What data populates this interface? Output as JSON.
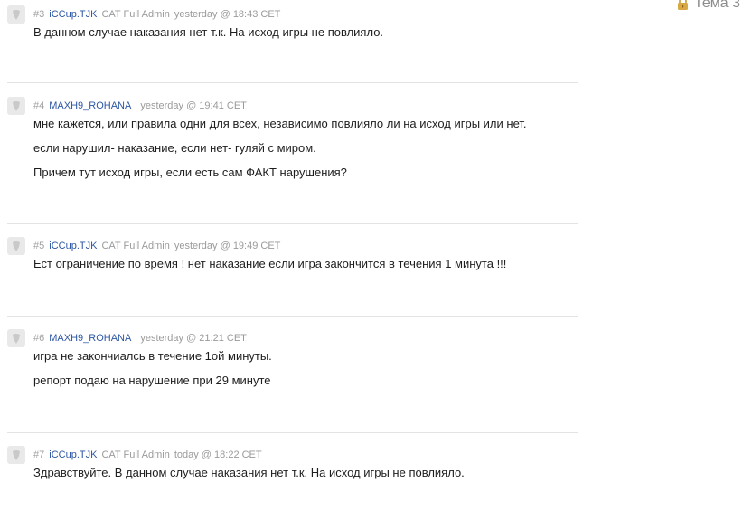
{
  "topic": {
    "label": "Тема 3"
  },
  "posts": [
    {
      "number": "#3",
      "author": "iCCup.TJK",
      "role": "CAT Full Admin",
      "time": "yesterday @ 18:43 CET",
      "lines": [
        "В данном случае наказания нет т.к. На исход игры не повлияло."
      ]
    },
    {
      "number": "#4",
      "author": "MAXH9_ROHANA",
      "role": "",
      "time": "yesterday @ 19:41 CET",
      "lines": [
        "мне кажется, или правила одни для всех, независимо повлияло ли на исход игры или нет.",
        "если нарушил- наказание, если нет- гуляй с миром.",
        "Причем тут исход игры, если есть сам ФАКТ нарушения?"
      ]
    },
    {
      "number": "#5",
      "author": "iCCup.TJK",
      "role": "CAT Full Admin",
      "time": "yesterday @ 19:49 CET",
      "lines": [
        "Ест ограничение по время ! нет наказание если игра закончится в течения 1 минута !!!"
      ]
    },
    {
      "number": "#6",
      "author": "MAXH9_ROHANA",
      "role": "",
      "time": "yesterday @ 21:21 CET",
      "lines": [
        "игра не закончиалсь в течение 1ой минуты.",
        "репорт подаю на нарушение при 29 минуте"
      ]
    },
    {
      "number": "#7",
      "author": "iCCup.TJK",
      "role": "CAT Full Admin",
      "time": "today @ 18:22 CET",
      "lines": [
        "Здравствуйте. В данном случае наказания нет т.к. На исход игры не повлияло."
      ]
    }
  ]
}
